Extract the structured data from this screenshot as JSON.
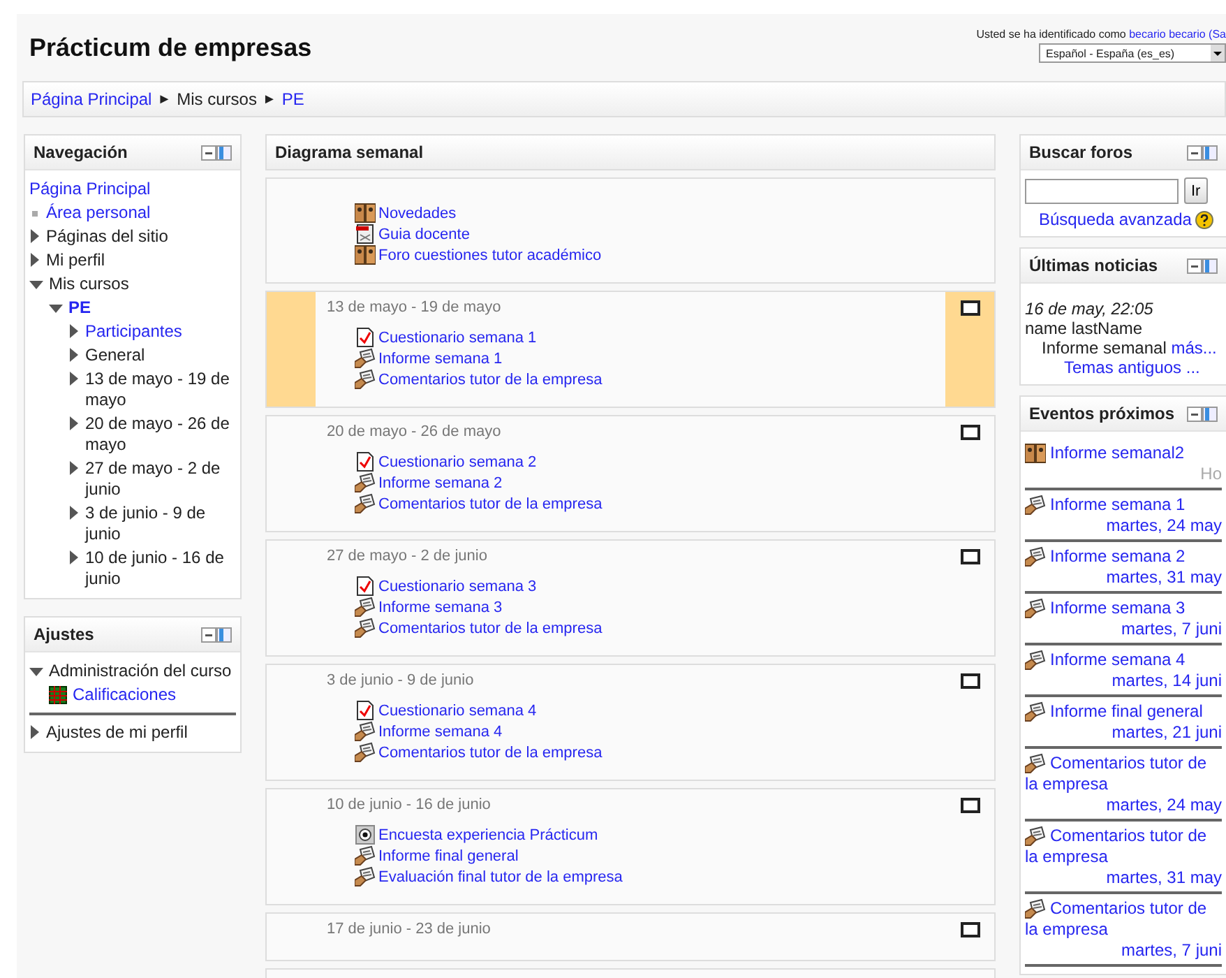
{
  "header": {
    "title": "Prácticum de empresas",
    "login_prefix": "Usted se ha identificado como",
    "login_user": "becario becario",
    "login_suffix": "(Sa",
    "language": "Español - España (es_es)"
  },
  "breadcrumb": [
    {
      "label": "Página Principal",
      "link": true
    },
    {
      "separator": "►",
      "label": "Mis cursos",
      "link": false
    },
    {
      "separator": "►",
      "label": "PE",
      "link": true
    }
  ],
  "navigation": {
    "title": "Navegación",
    "items": [
      {
        "label": "Página Principal",
        "kind": "plain",
        "link": true
      },
      {
        "label": "Área personal",
        "kind": "leaf",
        "link": true
      },
      {
        "label": "Páginas del sitio",
        "kind": "branch",
        "link": false,
        "expanded": false
      },
      {
        "label": "Mi perfil",
        "kind": "branch",
        "link": false,
        "expanded": false
      },
      {
        "label": "Mis cursos",
        "kind": "branch",
        "link": false,
        "expanded": true,
        "children": [
          {
            "label": "PE",
            "kind": "branch",
            "link": true,
            "current": true,
            "expanded": true,
            "children": [
              {
                "label": "Participantes",
                "kind": "branch",
                "link": true,
                "expanded": false
              },
              {
                "label": "General",
                "kind": "branch",
                "link": false,
                "expanded": false
              },
              {
                "label": "13 de mayo - 19 de mayo",
                "kind": "branch",
                "link": false,
                "expanded": false
              },
              {
                "label": "20 de mayo - 26 de mayo",
                "kind": "branch",
                "link": false,
                "expanded": false
              },
              {
                "label": "27 de mayo - 2 de junio",
                "kind": "branch",
                "link": false,
                "expanded": false
              },
              {
                "label": "3 de junio - 9 de junio",
                "kind": "branch",
                "link": false,
                "expanded": false
              },
              {
                "label": "10 de junio - 16 de junio",
                "kind": "branch",
                "link": false,
                "expanded": false
              }
            ]
          }
        ]
      }
    ]
  },
  "settings": {
    "title": "Ajustes",
    "items": [
      {
        "label": "Administración del curso",
        "kind": "branch",
        "link": false,
        "expanded": true,
        "children": [
          {
            "label": "Calificaciones",
            "kind": "grades",
            "link": true
          }
        ]
      },
      {
        "label": "Ajustes de mi perfil",
        "kind": "branch",
        "link": false,
        "expanded": false,
        "separated": true
      }
    ]
  },
  "main": {
    "title": "Diagrama semanal",
    "sections": [
      {
        "items": [
          {
            "label": "Novedades",
            "kind": "forum"
          },
          {
            "label": "Guia docente",
            "kind": "pdf"
          },
          {
            "label": "Foro cuestiones tutor académico",
            "kind": "forum"
          }
        ]
      },
      {
        "title": "13 de mayo - 19 de mayo",
        "current": true,
        "items": [
          {
            "label": "Cuestionario semana 1",
            "kind": "quiz"
          },
          {
            "label": "Informe semana 1",
            "kind": "assignment"
          },
          {
            "label": "Comentarios tutor de la empresa",
            "kind": "assignment"
          }
        ]
      },
      {
        "title": "20 de mayo - 26 de mayo",
        "current": false,
        "items": [
          {
            "label": "Cuestionario semana 2",
            "kind": "quiz"
          },
          {
            "label": "Informe semana 2",
            "kind": "assignment"
          },
          {
            "label": "Comentarios tutor de la empresa",
            "kind": "assignment"
          }
        ]
      },
      {
        "title": "27 de mayo - 2 de junio",
        "current": false,
        "items": [
          {
            "label": "Cuestionario semana 3",
            "kind": "quiz"
          },
          {
            "label": "Informe semana 3",
            "kind": "assignment"
          },
          {
            "label": "Comentarios tutor de la empresa",
            "kind": "assignment"
          }
        ]
      },
      {
        "title": "3 de junio - 9 de junio",
        "current": false,
        "items": [
          {
            "label": "Cuestionario semana 4",
            "kind": "quiz"
          },
          {
            "label": "Informe semana 4",
            "kind": "assignment"
          },
          {
            "label": "Comentarios tutor de la empresa",
            "kind": "assignment"
          }
        ]
      },
      {
        "title": "10 de junio - 16 de junio",
        "current": false,
        "items": [
          {
            "label": "Encuesta experiencia Prácticum",
            "kind": "survey"
          },
          {
            "label": "Informe final general",
            "kind": "assignment"
          },
          {
            "label": "Evaluación final tutor de la empresa",
            "kind": "assignment"
          }
        ]
      },
      {
        "title": "17 de junio - 23 de junio",
        "current": false
      },
      {
        "current": false
      }
    ]
  },
  "search_forums": {
    "title": "Buscar foros",
    "button": "Ir",
    "advanced": "Búsqueda avanzada"
  },
  "news": {
    "title": "Últimas noticias",
    "date": "16 de may, 22:05",
    "author": "name lastName",
    "subject": "Informe semanal",
    "more": "más...",
    "older": "Temas antiguos ..."
  },
  "events": {
    "title": "Eventos próximos",
    "items": [
      {
        "label": "Informe semanal2",
        "kind": "forum",
        "date": "Ho",
        "date_link": false
      },
      {
        "label": "Informe semana 1",
        "kind": "assignment",
        "date": "martes, 24 may",
        "date_link": true
      },
      {
        "label": "Informe semana 2",
        "kind": "assignment",
        "date": "martes, 31 may",
        "date_link": true
      },
      {
        "label": "Informe semana 3",
        "kind": "assignment",
        "date": "martes, 7 juni",
        "date_link": true
      },
      {
        "label": "Informe semana 4",
        "kind": "assignment",
        "date": "martes, 14 juni",
        "date_link": true
      },
      {
        "label": "Informe final general",
        "kind": "assignment",
        "date": "martes, 21 juni",
        "date_link": true
      },
      {
        "label": "Comentarios tutor de la empresa",
        "kind": "assignment",
        "date": "martes, 24 may",
        "date_link": true
      },
      {
        "label": "Comentarios tutor de la empresa",
        "kind": "assignment",
        "date": "martes, 31 may",
        "date_link": true
      },
      {
        "label": "Comentarios tutor de la empresa",
        "kind": "assignment",
        "date": "martes, 7 juni",
        "date_link": true
      }
    ]
  }
}
